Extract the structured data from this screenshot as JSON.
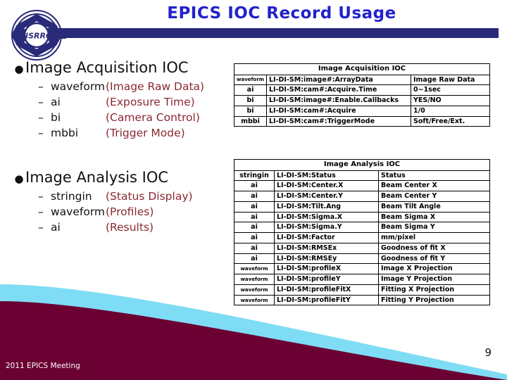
{
  "slide": {
    "title": "EPICS IOC Record Usage",
    "page_number": "9",
    "footer": "2011 EPICS Meeting",
    "logo_text": "NSRRC",
    "colors": {
      "title": "#2222cc",
      "header_bar": "#2a2a7a",
      "description": "#8a2832",
      "footer_band": "#6b0032",
      "footer_accent": "#7fdcf5"
    }
  },
  "bullets": [
    {
      "heading": "Image Acquisition IOC",
      "items": [
        {
          "record": "waveform",
          "desc": "(Image Raw Data)"
        },
        {
          "record": "ai",
          "desc": "(Exposure Time)"
        },
        {
          "record": "bi",
          "desc": "(Camera Control)"
        },
        {
          "record": "mbbi",
          "desc": "(Trigger Mode)"
        }
      ]
    },
    {
      "heading": "Image Analysis IOC",
      "items": [
        {
          "record": "stringin",
          "desc": "(Status Display)"
        },
        {
          "record": "waveform",
          "desc": "(Profiles)"
        },
        {
          "record": "ai",
          "desc": "(Results)"
        }
      ]
    }
  ],
  "tables": [
    {
      "caption": "Image Acquisition IOC",
      "rows": [
        {
          "type": "waveform",
          "pv": "LI-DI-SM:image#:ArrayData",
          "desc": "Image Raw Data"
        },
        {
          "type": "ai",
          "pv": "LI-DI-SM:cam#:Acquire.Time",
          "desc": "0~1sec"
        },
        {
          "type": "bi",
          "pv": "LI-DI-SM:image#:Enable.Callbacks",
          "desc": "YES/NO"
        },
        {
          "type": "bi",
          "pv": "LI-DI-SM:cam#:Acquire",
          "desc": "1/0"
        },
        {
          "type": "mbbi",
          "pv": "LI-DI-SM:cam#:TriggerMode",
          "desc": "Soft/Free/Ext."
        }
      ]
    },
    {
      "caption": "Image Analysis IOC",
      "rows": [
        {
          "type": "stringin",
          "pv": "LI-DI-SM:Status",
          "desc": "Status"
        },
        {
          "type": "ai",
          "pv": "LI-DI-SM:Center.X",
          "desc": "Beam Center X"
        },
        {
          "type": "ai",
          "pv": "LI-DI-SM:Center.Y",
          "desc": "Beam Center Y"
        },
        {
          "type": "ai",
          "pv": "LI-DI-SM:Tilt.Ang",
          "desc": "Beam Tilt Angle"
        },
        {
          "type": "ai",
          "pv": "LI-DI-SM:Sigma.X",
          "desc": "Beam Sigma X"
        },
        {
          "type": "ai",
          "pv": "LI-DI-SM:Sigma.Y",
          "desc": "Beam Sigma Y"
        },
        {
          "type": "ai",
          "pv": "LI-DI-SM:Factor",
          "desc": "mm/pixel"
        },
        {
          "type": "ai",
          "pv": "LI-DI-SM:RMSEx",
          "desc": "Goodness of fit X"
        },
        {
          "type": "ai",
          "pv": "LI-DI-SM:RMSEy",
          "desc": "Goodness of fit Y"
        },
        {
          "type": "waveform",
          "pv": "LI-DI-SM:profileX",
          "desc": "Image X Projection"
        },
        {
          "type": "waveform",
          "pv": "LI-DI-SM:profileY",
          "desc": "Image Y Projection"
        },
        {
          "type": "waveform",
          "pv": "LI-DI-SM:profileFitX",
          "desc": "Fitting X Projection"
        },
        {
          "type": "waveform",
          "pv": "LI-DI-SM:profileFitY",
          "desc": "Fitting Y Projection"
        }
      ]
    }
  ]
}
